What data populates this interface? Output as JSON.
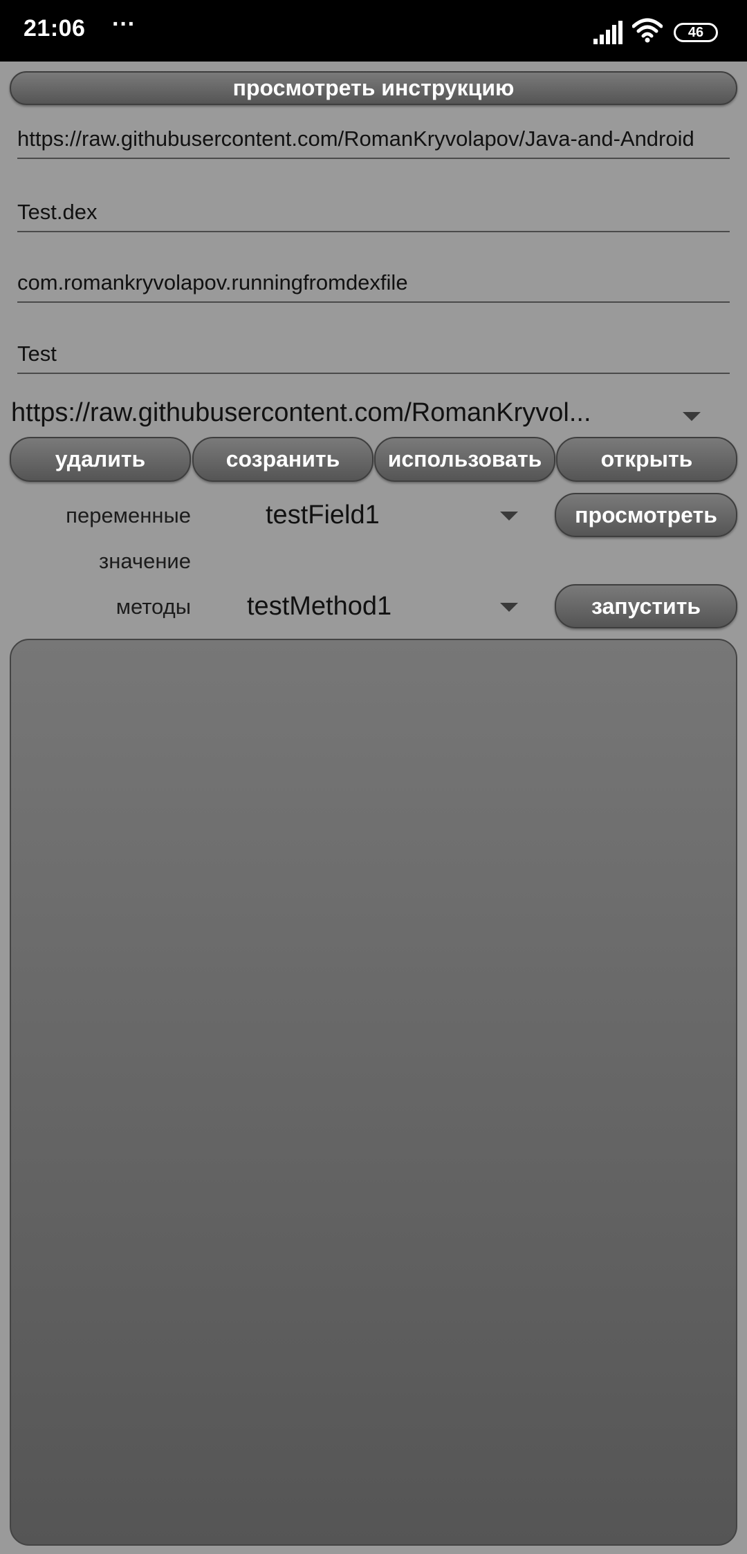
{
  "status_bar": {
    "time": "21:06",
    "dots": "···",
    "battery": "46",
    "icons": [
      "signal-icon",
      "wifi-icon",
      "battery-icon"
    ]
  },
  "instruction_button": "просмотреть инструкцию",
  "fields": {
    "url": "https://raw.githubusercontent.com/RomanKryvolapov/Java-and-Android",
    "file_name": "Test.dex",
    "package_name": "com.romankryvolapov.runningfromdexfile",
    "class_name": "Test"
  },
  "saved_urls_spinner": {
    "selected": "https://raw.githubusercontent.com/RomanKryvol..."
  },
  "action_buttons": {
    "delete": "удалить",
    "save": "созранить",
    "use": "использовать",
    "open": "открыть"
  },
  "variables": {
    "label": "переменные",
    "selected": "testField1",
    "view_button": "просмотреть",
    "value_label": "значение"
  },
  "methods": {
    "label": "методы",
    "selected": "testMethod1",
    "run_button": "запустить"
  },
  "colors": {
    "background": "#9a9a9a",
    "status_bar": "#000000",
    "button_top": "#7a7a7a",
    "button_bottom": "#555555",
    "panel": "#666666"
  }
}
